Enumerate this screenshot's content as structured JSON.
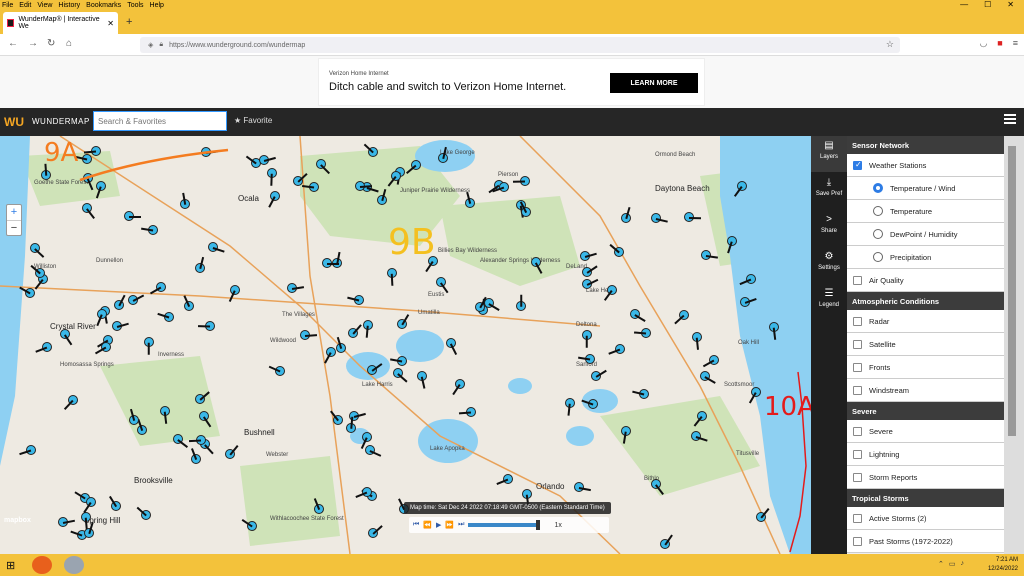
{
  "menubar": {
    "items": [
      "File",
      "Edit",
      "View",
      "History",
      "Bookmarks",
      "Tools",
      "Help"
    ]
  },
  "window_controls": [
    "—",
    "☐",
    "✕"
  ],
  "browser": {
    "tab_title": "WunderMap® | Interactive We",
    "tab_close": "✕",
    "new_tab": "+",
    "url": "https://www.wunderground.com/wundermap",
    "nav": {
      "back": "←",
      "forward": "→",
      "reload": "↻",
      "home": "⌂"
    }
  },
  "ad": {
    "small": "Verizon Home Internet",
    "headline": "Ditch cable and switch to Verizon Home Internet.",
    "cta": "LEARN MORE"
  },
  "wundermap": {
    "logo": "WU",
    "brand": "WUNDERMAP",
    "search_placeholder": "Search & Favorites",
    "favorite": "Favorite"
  },
  "toolbar": [
    {
      "icon": "layers-icon",
      "glyph": "▤",
      "label": "Layers"
    },
    {
      "icon": "save-icon",
      "glyph": "⤓",
      "label": "Save Pref"
    },
    {
      "icon": "share-icon",
      "glyph": ">",
      "label": "Share"
    },
    {
      "icon": "gear-icon",
      "glyph": "⚙",
      "label": "Settings"
    },
    {
      "icon": "legend-icon",
      "glyph": "☰",
      "label": "Legend"
    }
  ],
  "panel": {
    "sensor_network": "Sensor Network",
    "weather_stations": "Weather Stations",
    "temp_wind": "Temperature / Wind",
    "temperature": "Temperature",
    "dewpoint": "DewPoint / Humidity",
    "precip": "Precipitation",
    "air_quality": "Air Quality",
    "atmospheric": "Atmospheric Conditions",
    "radar": "Radar",
    "satellite": "Satellite",
    "fronts": "Fronts",
    "windstream": "Windstream",
    "severe_header": "Severe",
    "severe": "Severe",
    "lightning": "Lightning",
    "storm_reports": "Storm Reports",
    "tropical": "Tropical Storms",
    "active_storms": "Active Storms (2)",
    "past_storms": "Past Storms (1972-2022)"
  },
  "map": {
    "labels": {
      "ocala": "Ocala",
      "daytona": "Daytona Beach",
      "ormond": "Ormond Beach",
      "orlando": "Orlando",
      "deltona": "Deltona",
      "sanford": "Sanford",
      "titusville": "Titusville",
      "lake_george": "Lake George",
      "pierson": "Pierson",
      "juniper": "Juniper Prairie Wilderness",
      "alexander": "Alexander Springs Wilderness",
      "billies": "Billies Bay Wilderness",
      "dunnellon": "Dunnellon",
      "crystal_river": "Crystal River",
      "homosassa": "Homosassa Springs",
      "inverness": "Inverness",
      "bushnell": "Bushnell",
      "brooksville": "Brooksville",
      "wildwood": "Wildwood",
      "villages": "The Villages",
      "umatilla": "Umatilla",
      "eustis": "Eustis",
      "lake_helen": "Lake Helen",
      "lake_apopka": "Lake Apopka",
      "lake_harris": "Lake Harris",
      "webster": "Webster",
      "goethe": "Goethe State Forest",
      "withlacoochee": "Withlacoochee State Forest",
      "oak_hill": "Oak Hill",
      "scottsmoor": "Scottsmoor",
      "bithlo": "Bithlo",
      "spring_hill": "Spring Hill",
      "williston": "Williston",
      "deland": "DeLand"
    },
    "annotations": [
      "9A",
      "9B",
      "10A"
    ],
    "zoom_in": "+",
    "zoom_out": "−",
    "attribution": "mapbox",
    "map_time": "Map time: Sat Dec 24 2022 07:18:49 GMT-0500 (Eastern Standard Time)",
    "speed": "1x"
  },
  "taskbar": {
    "time": "7:21 AM",
    "date": "12/24/2022"
  }
}
